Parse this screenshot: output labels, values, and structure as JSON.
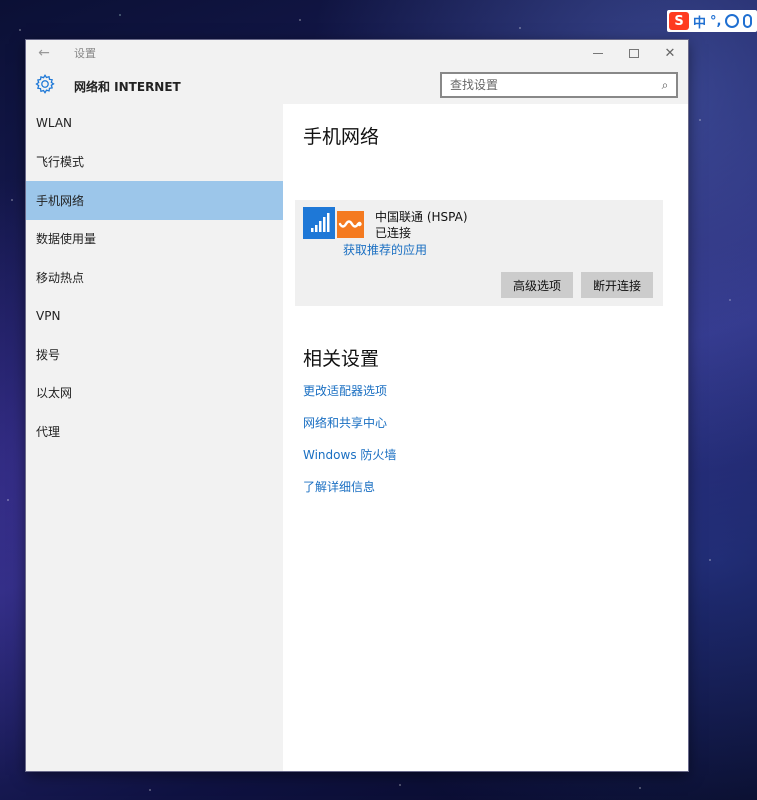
{
  "ime": {
    "logo": "S",
    "lang": "中",
    "punct": "°,",
    "icons": [
      "smile-icon",
      "mic-icon"
    ]
  },
  "window": {
    "title": "设置",
    "back": "←",
    "controls": [
      "minimize",
      "maximize",
      "close"
    ]
  },
  "header": {
    "section_title": "网络和 INTERNET",
    "search_placeholder": "查找设置"
  },
  "sidebar": {
    "items": [
      {
        "label": "WLAN",
        "active": false
      },
      {
        "label": "飞行模式",
        "active": false
      },
      {
        "label": "手机网络",
        "active": true
      },
      {
        "label": "数据使用量",
        "active": false
      },
      {
        "label": "移动热点",
        "active": false
      },
      {
        "label": "VPN",
        "active": false
      },
      {
        "label": "拨号",
        "active": false
      },
      {
        "label": "以太网",
        "active": false
      },
      {
        "label": "代理",
        "active": false
      }
    ]
  },
  "main": {
    "title": "手机网络",
    "carrier": {
      "name": "中国联通 (HSPA)",
      "status": "已连接",
      "app_link": "获取推荐的应用",
      "advanced_button": "高级选项",
      "disconnect_button": "断开连接"
    },
    "related_title": "相关设置",
    "related_links": [
      "更改适配器选项",
      "网络和共享中心",
      "Windows 防火墙",
      "了解详细信息"
    ]
  },
  "colors": {
    "accent": "#1e78d7",
    "active_nav": "#9cc6ea",
    "link": "#1a6fc2",
    "carrier_brand": "#f47a20"
  }
}
